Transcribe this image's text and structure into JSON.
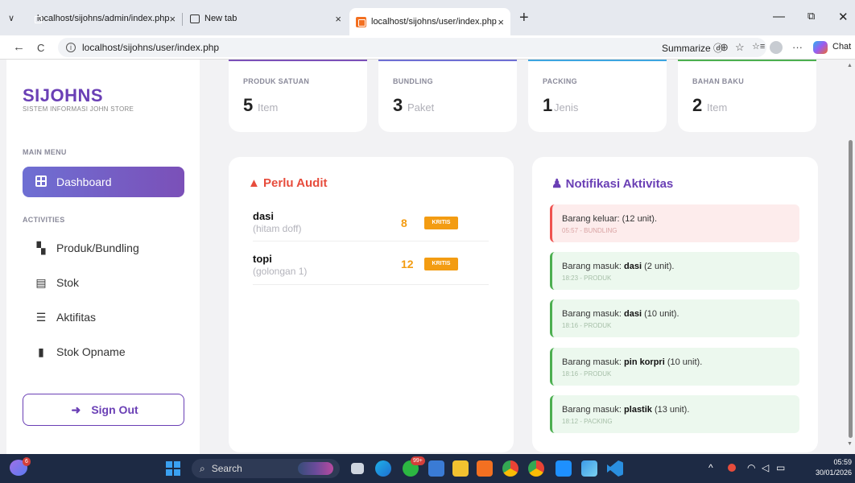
{
  "browser": {
    "tabs": [
      {
        "title": "localhost/sijohns/admin/index.php",
        "active": false
      },
      {
        "title": "New tab",
        "active": false
      },
      {
        "title": "localhost/sijohns/user/index.php",
        "active": true
      }
    ],
    "close_glyph": "×",
    "new_tab_glyph": "+",
    "window_controls": {
      "minimize": "—",
      "restore": "⧉",
      "close": "✕"
    },
    "nav": {
      "back": "←",
      "reload": "C",
      "info": "i"
    },
    "address": "localhost/sijohns/user/index.php",
    "summarize_label": "Summarize",
    "toolbar_glyphs": {
      "summarize": "ⓓ",
      "zoom": "⊕",
      "favorite": "☆",
      "favorites_list": "☆≡",
      "more": "···"
    },
    "chat_label": "Chat"
  },
  "sidebar": {
    "brand": "SIJOHNS",
    "brand_sub": "SISTEM INFORMASI JOHN STORE",
    "main_menu_label": "MAIN MENU",
    "dashboard_label": "Dashboard",
    "activities_label": "ACTIVITIES",
    "items": [
      {
        "label": "Produk/Bundling",
        "icon": "boxes-icon",
        "glyph": "▚"
      },
      {
        "label": "Stok",
        "icon": "warehouse-icon",
        "glyph": "▤"
      },
      {
        "label": "Aktifitas",
        "icon": "list-check-icon",
        "glyph": "☰"
      },
      {
        "label": "Stok Opname",
        "icon": "clipboard-icon",
        "glyph": "▮"
      }
    ],
    "signout_label": "Sign Out",
    "signout_glyph": "➜"
  },
  "stats": [
    {
      "title": "PRODUK SATUAN",
      "value": "5",
      "unit": "Item",
      "accent": "#7b50b8"
    },
    {
      "title": "BUNDLING",
      "value": "3",
      "unit": "Paket",
      "accent": "#6e6fd3"
    },
    {
      "title": "PACKING",
      "value": "1",
      "unit": "Jenis",
      "accent": "#3da5e0"
    },
    {
      "title": "BAHAN BAKU",
      "value": "2",
      "unit": "Item",
      "accent": "#4caf50"
    }
  ],
  "audit": {
    "title": "Perlu Audit",
    "icon_glyph": "▲",
    "title_color": "#e74c3c",
    "rows": [
      {
        "name": "dasi",
        "sub": "(hitam doff)",
        "qty": "8",
        "badge": "KRITIS"
      },
      {
        "name": "topi",
        "sub": "(golongan 1)",
        "qty": "12",
        "badge": "KRITIS"
      }
    ]
  },
  "notifications": {
    "title": "Notifikasi Aktivitas",
    "icon_glyph": "♟",
    "title_color": "#6a3fb5",
    "items": [
      {
        "prefix": "Barang keluar: ",
        "item": "",
        "suffix": "(12 unit).",
        "meta": "05:57 - BUNDLING",
        "type": "out"
      },
      {
        "prefix": "Barang masuk: ",
        "item": "dasi",
        "suffix": " (2 unit).",
        "meta": "18:23 - PRODUK",
        "type": "in"
      },
      {
        "prefix": "Barang masuk: ",
        "item": "dasi",
        "suffix": " (10 unit).",
        "meta": "18:16 - PRODUK",
        "type": "in"
      },
      {
        "prefix": "Barang masuk: ",
        "item": "pin korpri",
        "suffix": " (10 unit).",
        "meta": "18:16 - PRODUK",
        "type": "in"
      },
      {
        "prefix": "Barang masuk: ",
        "item": "plastik",
        "suffix": " (13 unit).",
        "meta": "18:12 - PACKING",
        "type": "in"
      }
    ]
  },
  "taskbar": {
    "search_label": "Search",
    "weather_badge": "6",
    "app_badge": "99+",
    "time": "05:59",
    "date": "30/01/2026",
    "tray_glyphs": {
      "chevron": "^",
      "wifi": "◠",
      "volume": "◁",
      "battery": "▭"
    }
  }
}
